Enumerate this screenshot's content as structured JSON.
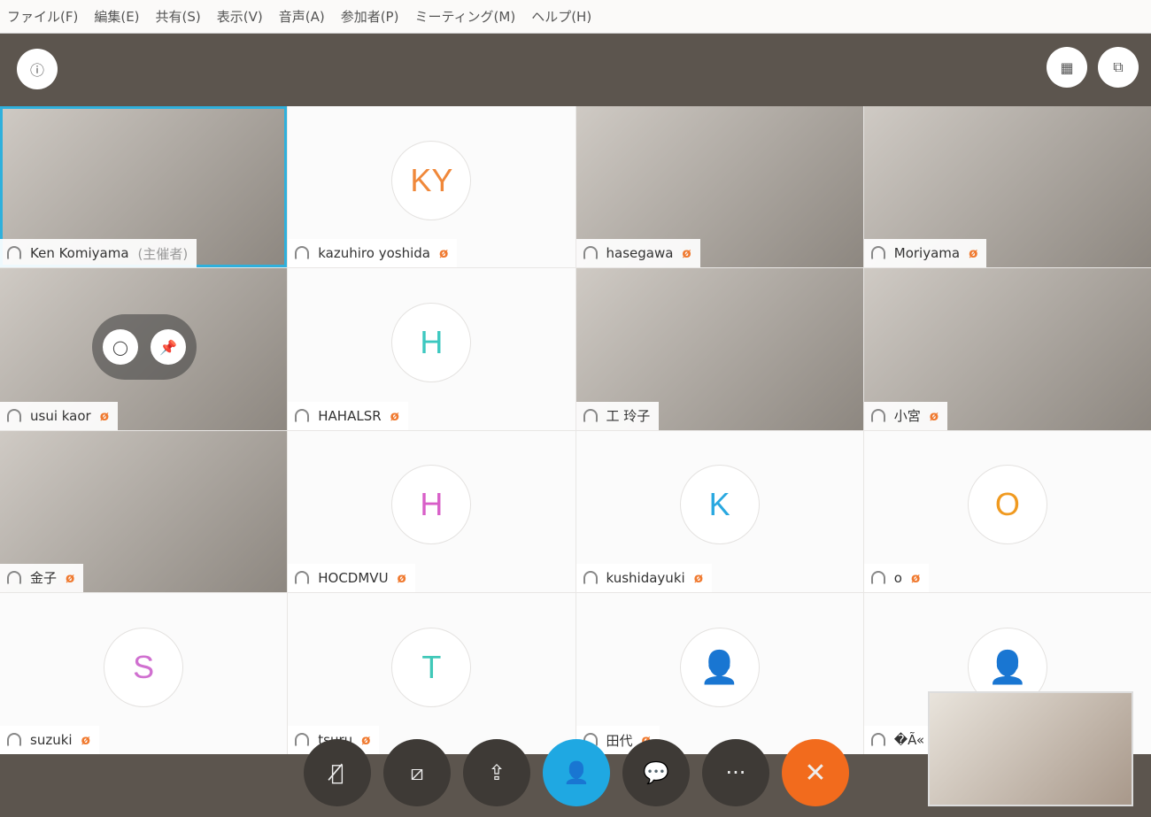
{
  "menu": [
    "ファイル(F)",
    "編集(E)",
    "共有(S)",
    "表示(V)",
    "音声(A)",
    "参加者(P)",
    "ミーティング(M)",
    "ヘルプ(H)"
  ],
  "topbar": {
    "info_icon": "ⓘ",
    "grid_icon": "▦",
    "window_icon": "⧉"
  },
  "participants": [
    {
      "name": "Ken Komiyama",
      "role": "(主催者)",
      "type": "video",
      "active": true,
      "muted": false
    },
    {
      "name": "kazuhiro  yoshida",
      "initials": "KY",
      "color": "#f0883a",
      "muted": true
    },
    {
      "name": "hasegawa",
      "type": "video",
      "muted": true
    },
    {
      "name": "Moriyama",
      "type": "video",
      "muted": true
    },
    {
      "name": "usui kaor",
      "type": "video",
      "muted": true,
      "hover": true
    },
    {
      "name": "HAHALSR",
      "initials": "H",
      "color": "#3cc8c0",
      "muted": true
    },
    {
      "name": "工  玲子",
      "type": "video",
      "muted": false
    },
    {
      "name": "小宮",
      "type": "video",
      "muted": true
    },
    {
      "name": "金子",
      "type": "video",
      "muted": true
    },
    {
      "name": "HOCDMVU",
      "initials": "H",
      "color": "#d85fc8",
      "muted": true
    },
    {
      "name": "kushidayuki",
      "initials": "K",
      "color": "#29a8e0",
      "muted": true
    },
    {
      "name": "o",
      "initials": "O",
      "color": "#f09a20",
      "muted": true
    },
    {
      "name": "suzuki",
      "initials": "S",
      "color": "#d070d0",
      "muted": true
    },
    {
      "name": "tsuru",
      "initials": "T",
      "color": "#40c8b8",
      "muted": true
    },
    {
      "name": "田代",
      "initials": "",
      "muted": true
    },
    {
      "name": "�Ã«",
      "initials": "",
      "muted": false
    }
  ],
  "controls": {
    "mute": "🎙̸",
    "video": "⧄",
    "share": "⇪",
    "participants": "👤",
    "chat": "💬",
    "more": "···",
    "leave": "✕"
  },
  "icons": {
    "muted": "ø",
    "chat": "◯",
    "pin": "📌",
    "generic_avatar": "👤"
  }
}
